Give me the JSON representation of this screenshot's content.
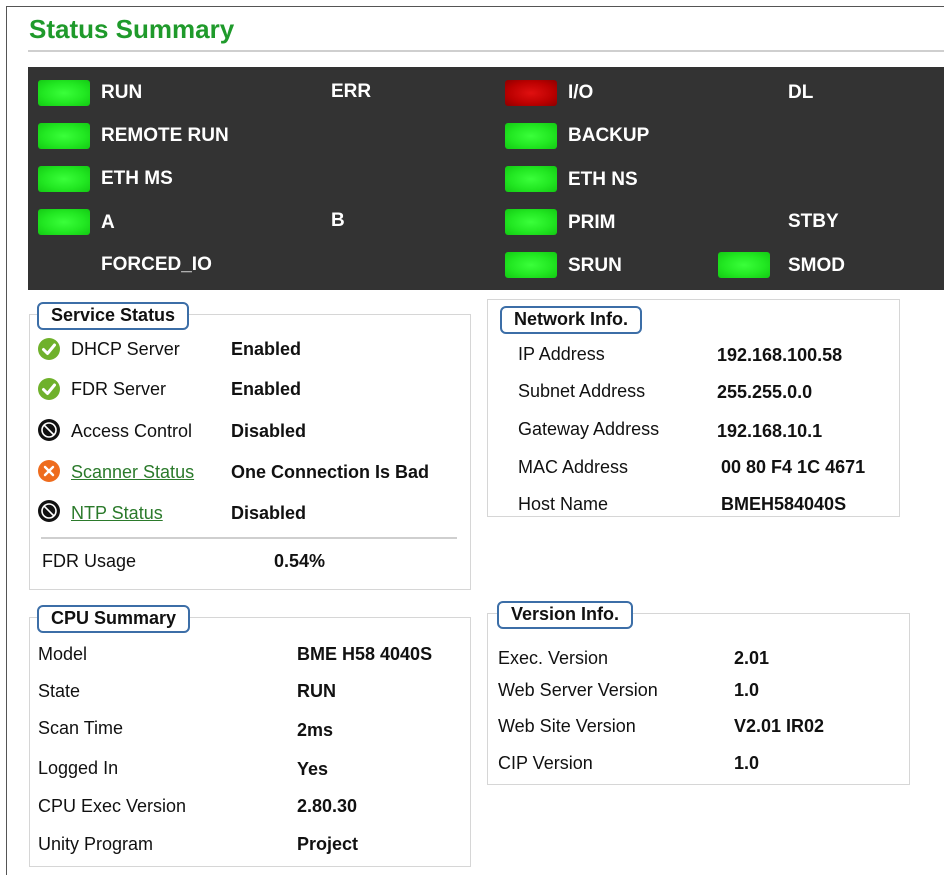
{
  "header": {
    "title": "Status Summary"
  },
  "leds": {
    "run": "RUN",
    "err": "ERR",
    "io": "I/O",
    "dl": "DL",
    "remote_run": "REMOTE RUN",
    "backup": "BACKUP",
    "eth_ms": "ETH MS",
    "eth_ns": "ETH NS",
    "a": "A",
    "b": "B",
    "prim": "PRIM",
    "stby": "STBY",
    "forced_io": "FORCED_IO",
    "srun": "SRUN",
    "smod": "SMOD",
    "colors": {
      "green": "#22e822",
      "red": "#bb0000",
      "panel": "#333333"
    }
  },
  "service_status": {
    "title": "Service Status",
    "rows": [
      {
        "label": "DHCP Server",
        "value": "Enabled",
        "icon": "check-icon"
      },
      {
        "label": "FDR Server",
        "value": "Enabled",
        "icon": "check-icon"
      },
      {
        "label": "Access Control",
        "value": "Disabled",
        "icon": "disabled-icon"
      },
      {
        "label": "Scanner Status",
        "value": "One Connection Is Bad",
        "icon": "error-x-icon"
      },
      {
        "label": "NTP Status",
        "value": "Disabled",
        "icon": "disabled-icon"
      }
    ],
    "fdr_usage_label": "FDR Usage",
    "fdr_usage_value": "0.54%"
  },
  "network_info": {
    "title": "Network Info.",
    "rows": [
      {
        "label": "IP Address",
        "value": "192.168.100.58"
      },
      {
        "label": "Subnet Address",
        "value": "255.255.0.0"
      },
      {
        "label": "Gateway Address",
        "value": "192.168.10.1"
      },
      {
        "label": "MAC Address",
        "value": "00 80 F4 1C 4671"
      },
      {
        "label": "Host Name",
        "value": "BMEH584040S"
      }
    ]
  },
  "cpu_summary": {
    "title": "CPU Summary",
    "rows": [
      {
        "label": "Model",
        "value": "BME H58 4040S"
      },
      {
        "label": "State",
        "value": "RUN"
      },
      {
        "label": "Scan Time",
        "value": "2ms"
      },
      {
        "label": "Logged In",
        "value": "Yes"
      },
      {
        "label": "CPU Exec Version",
        "value": "2.80.30"
      },
      {
        "label": "Unity Program",
        "value": "Project"
      }
    ]
  },
  "version_info": {
    "title": "Version Info.",
    "rows": [
      {
        "label": "Exec. Version",
        "value": "2.01"
      },
      {
        "label": "Web Server Version",
        "value": "1.0"
      },
      {
        "label": "Web Site Version",
        "value": "V2.01 IR02"
      },
      {
        "label": "CIP Version",
        "value": "1.0"
      }
    ]
  }
}
